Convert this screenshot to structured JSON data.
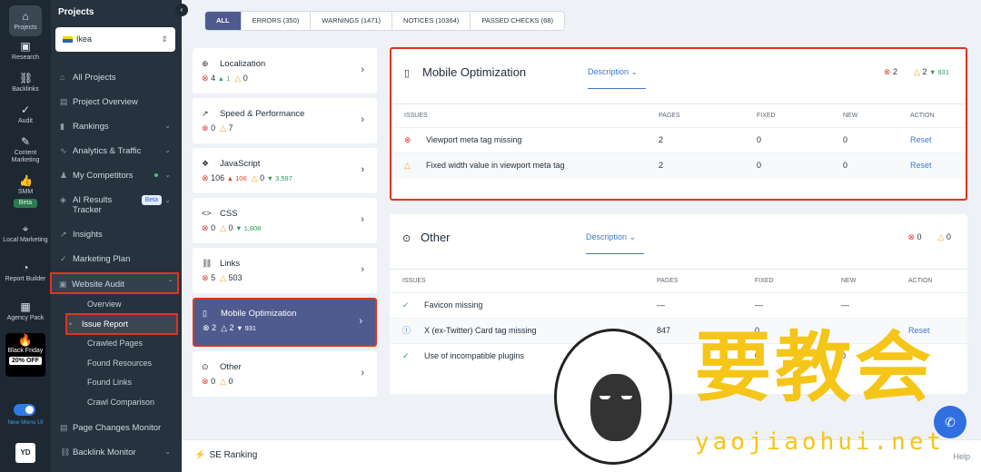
{
  "rail": {
    "items": [
      {
        "icon": "home-icon",
        "label": "Projects",
        "glyph": "⌂"
      },
      {
        "icon": "research-icon",
        "label": "Research",
        "glyph": "▣"
      },
      {
        "icon": "backlinks-icon",
        "label": "Backlinks",
        "glyph": "⛓"
      },
      {
        "icon": "audit-icon",
        "label": "Audit",
        "glyph": "✓"
      },
      {
        "icon": "content-marketing-icon",
        "label": "Content Marketing",
        "glyph": "✎"
      },
      {
        "icon": "smm-icon",
        "label": "SMM",
        "glyph": "👍",
        "badge": "Beta"
      },
      {
        "icon": "local-marketing-icon",
        "label": "Local Marketing",
        "glyph": "⌖"
      },
      {
        "icon": "report-builder-icon",
        "label": "Report Builder",
        "glyph": "◔"
      },
      {
        "icon": "agency-pack-icon",
        "label": "Agency Pack",
        "glyph": "▦"
      }
    ],
    "promo": {
      "title": "Black Friday",
      "discount": "20% OFF"
    },
    "toggle_label": "New Menu UI",
    "avatar": "YD"
  },
  "panel": {
    "title": "Projects",
    "project": "Ikea",
    "nav": [
      {
        "label": "All Projects",
        "glyph": "⌂"
      },
      {
        "label": "Project Overview",
        "glyph": "▤"
      },
      {
        "label": "Rankings",
        "glyph": "▮",
        "chev": "⌄"
      },
      {
        "label": "Analytics & Traffic",
        "glyph": "∿",
        "chev": "⌄"
      },
      {
        "label": "My Competitors",
        "glyph": "♟",
        "chev": "⌄"
      },
      {
        "label": "AI Results Tracker",
        "glyph": "◈",
        "chev": "⌄",
        "badge": "Beta"
      },
      {
        "label": "Insights",
        "glyph": "↗"
      },
      {
        "label": "Marketing Plan",
        "glyph": "✓"
      },
      {
        "label": "Website Audit",
        "glyph": "▣",
        "chev": "⌃"
      },
      {
        "label": "Page Changes Monitor",
        "glyph": "▤"
      },
      {
        "label": "Backlink Monitor",
        "glyph": "⛓",
        "chev": "⌄"
      }
    ],
    "subnav": [
      "Overview",
      "Issue Report",
      "Crawled Pages",
      "Found Resources",
      "Found Links",
      "Crawl Comparison"
    ]
  },
  "filters": [
    "ALL",
    "ERRORS (350)",
    "WARNINGS (1471)",
    "NOTICES (10364)",
    "PASSED CHECKS (68)"
  ],
  "categories": [
    {
      "name": "Localization",
      "glyph": "⊕",
      "errors": "4",
      "err_delta": "▲ 1",
      "warnings": "0",
      "extra": ""
    },
    {
      "name": "Speed & Performance",
      "glyph": "↗",
      "errors": "0",
      "err_delta": "",
      "warnings": "7",
      "extra": ""
    },
    {
      "name": "JavaScript",
      "glyph": "❖",
      "errors": "106",
      "err_delta": "▲ 106",
      "warnings": "0",
      "extra": "▼ 3,597"
    },
    {
      "name": "CSS",
      "glyph": "<>",
      "errors": "0",
      "err_delta": "",
      "warnings": "0",
      "extra": "▼ 1,808"
    },
    {
      "name": "Links",
      "glyph": "⛓",
      "errors": "5",
      "err_delta": "",
      "warnings": "503",
      "extra": ""
    },
    {
      "name": "Mobile Optimization",
      "glyph": "▯",
      "errors": "2",
      "err_delta": "",
      "warnings": "2",
      "extra": "▼ 931"
    },
    {
      "name": "Other",
      "glyph": "⊙",
      "errors": "0",
      "err_delta": "",
      "warnings": "0",
      "extra": ""
    }
  ],
  "cards": [
    {
      "title": "Mobile Optimization",
      "glyph": "▯",
      "description": "Description ⌄",
      "errors": "2",
      "warnings": "2",
      "extra": "▼ 931",
      "columns": [
        "ISSUES",
        "PAGES",
        "FIXED",
        "NEW",
        "ACTION"
      ],
      "rows": [
        {
          "status": "error",
          "issue": "Viewport meta tag missing",
          "pages": "2",
          "fixed": "0",
          "new": "0",
          "action": "Reset"
        },
        {
          "status": "warning",
          "issue": "Fixed width value in viewport meta tag",
          "pages": "2",
          "fixed": "0",
          "new": "0",
          "action": "Reset"
        }
      ]
    },
    {
      "title": "Other",
      "glyph": "⊙",
      "description": "Description ⌄",
      "errors": "0",
      "warnings": "0",
      "extra": "",
      "columns": [
        "ISSUES",
        "PAGES",
        "FIXED",
        "NEW",
        "ACTION"
      ],
      "rows": [
        {
          "status": "passed",
          "issue": "Favicon missing",
          "pages": "—",
          "fixed": "—",
          "new": "—",
          "action": ""
        },
        {
          "status": "notice",
          "issue": "X (ex-Twitter) Card tag missing",
          "pages": "847",
          "fixed": "0",
          "new": "",
          "action": "Reset"
        },
        {
          "status": "passed",
          "issue": "Use of incompatible plugins",
          "pages": "0",
          "fixed": "0",
          "new": "0",
          "action": ""
        }
      ]
    }
  ],
  "footer": {
    "brand": "SE Ranking",
    "help": "Help"
  },
  "watermark": {
    "text": "要教会",
    "url": "yaojiaohui.net"
  },
  "colors": {
    "accent": "#4f5a8e",
    "highlight": "#e1341e",
    "error": "#e0412d",
    "warning": "#f0a422",
    "link": "#3f78c9"
  }
}
